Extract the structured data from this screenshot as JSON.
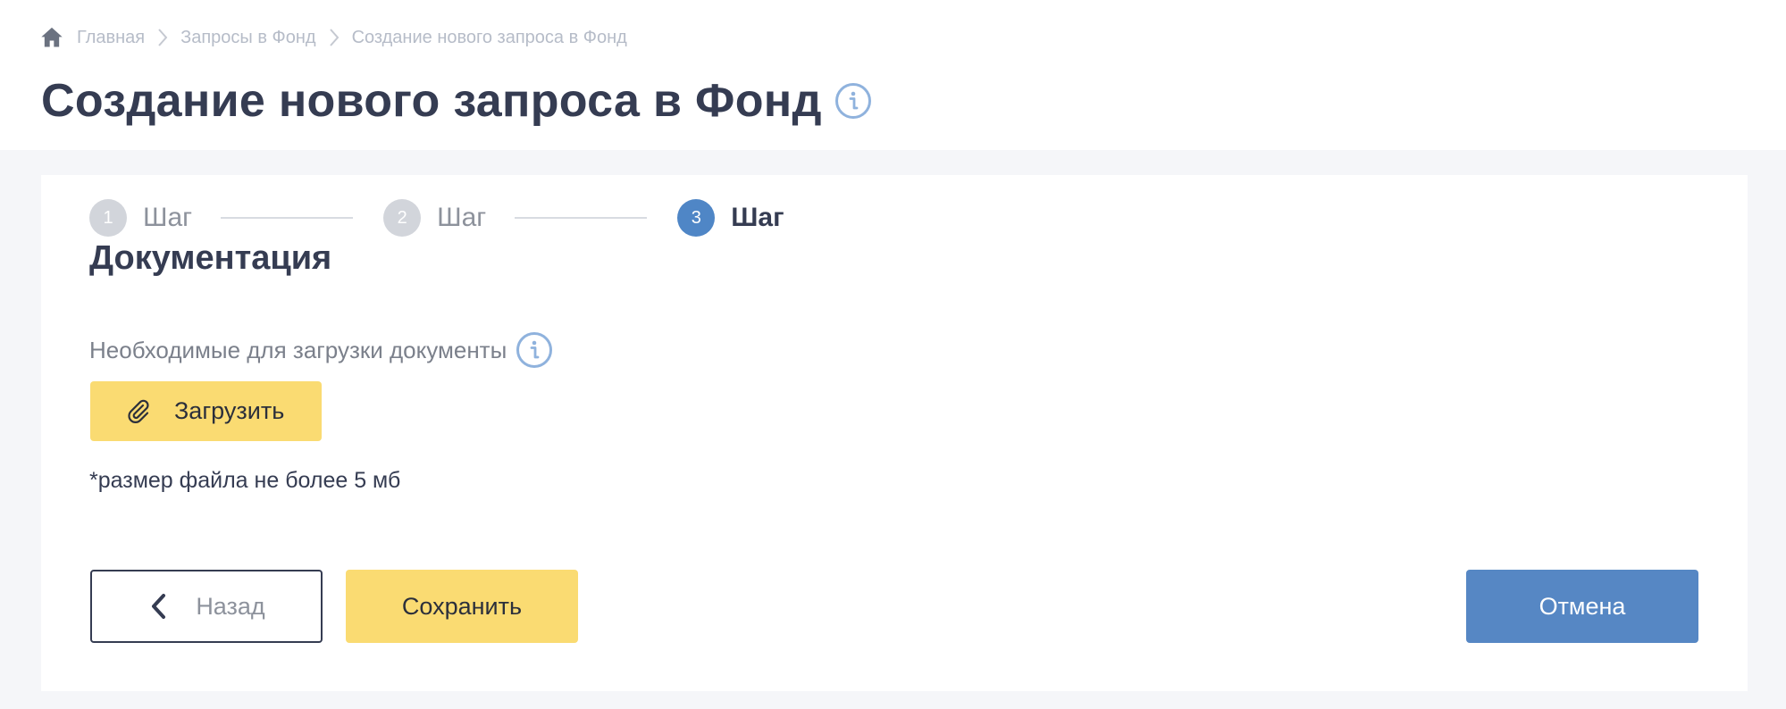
{
  "breadcrumb": {
    "home_icon": "home-icon",
    "home_label": "Главная",
    "items": [
      "Запросы в Фонд"
    ],
    "current": "Создание нового запроса в Фонд"
  },
  "page": {
    "title": "Создание нового запроса в Фонд",
    "info_icon": "info-icon"
  },
  "stepper": {
    "steps": [
      {
        "number": "1",
        "label": "Шаг",
        "active": false
      },
      {
        "number": "2",
        "label": "Шаг",
        "active": false
      },
      {
        "number": "3",
        "label": "Шаг",
        "active": true
      }
    ]
  },
  "section": {
    "title": "Документация",
    "docs_label": "Необходимые для загрузки документы",
    "upload_label": "Загрузить",
    "upload_icon": "paperclip-icon",
    "file_note": "*размер файла не более 5 мб"
  },
  "actions": {
    "back_label": "Назад",
    "save_label": "Сохранить",
    "cancel_label": "Отмена"
  },
  "colors": {
    "accent_blue": "#4f86c6",
    "button_yellow": "#fadb72",
    "text_dark": "#353c52",
    "background": "#f5f6f9"
  }
}
